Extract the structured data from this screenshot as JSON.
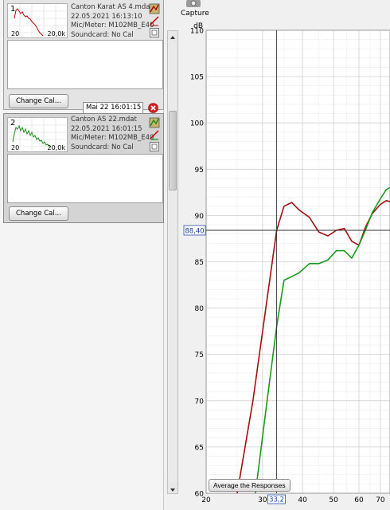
{
  "measurements": [
    {
      "index": "1",
      "thumb_lo": "20",
      "thumb_hi": "20,0k",
      "filename": "Canton Karat AS 4.mdat",
      "date": "22.05.2021 16:13:10",
      "mic": "Mic/Meter: M102MB_E40",
      "soundcard": "Soundcard: No Cal",
      "change_cal": "Change Cal...",
      "color": "#c00000"
    },
    {
      "index": "2",
      "thumb_lo": "20",
      "thumb_hi": "20,0k",
      "name_field": "Mai 22 16:01:15",
      "filename": "Canton AS 22.mdat",
      "date": "22.05.2021 16:01:15",
      "mic": "Mic/Meter: M102MB_E40",
      "soundcard": "Soundcard: No Cal",
      "change_cal": "Change Cal...",
      "color": "#1a8a1a"
    }
  ],
  "toolbar": {
    "capture_label": "Capture"
  },
  "graph": {
    "y_unit": "dB",
    "y_ticks": [
      "110",
      "105",
      "100",
      "95",
      "90",
      "85",
      "80",
      "75",
      "70",
      "65",
      "60"
    ],
    "x_ticks": [
      "20",
      "30",
      "40",
      "50",
      "60",
      "70"
    ],
    "cursor_y_label": "88,40",
    "cursor_x_label": "33,2",
    "average_button": "Average the Responses"
  },
  "chart_data": {
    "type": "line",
    "xlabel": "",
    "ylabel": "dB",
    "ylim": [
      60,
      110
    ],
    "xlim": [
      20,
      75
    ],
    "x_scale": "log",
    "cursor": {
      "x": 33.2,
      "y": 88.4
    },
    "series": [
      {
        "color": "#a01010",
        "x": [
          25,
          28,
          31,
          33.2,
          35,
          37,
          39,
          42,
          45,
          48,
          51,
          54,
          57,
          60,
          63,
          66,
          70,
          73,
          75
        ],
        "y": [
          60,
          70,
          81,
          88.4,
          91,
          91.4,
          90.6,
          89.8,
          88.2,
          87.8,
          88.4,
          88.6,
          87.2,
          86.8,
          88.8,
          90.2,
          91.2,
          91.6,
          91.5
        ]
      },
      {
        "color": "#1a9a1a",
        "x": [
          28.5,
          31,
          33.2,
          35,
          37,
          39,
          42,
          45,
          48,
          51,
          54,
          57,
          60,
          63,
          66,
          70,
          73,
          75
        ],
        "y": [
          60,
          70,
          78,
          83,
          83.4,
          83.8,
          84.8,
          84.8,
          85.2,
          86.2,
          86.2,
          85.4,
          86.8,
          88.5,
          90.3,
          91.8,
          92.8,
          93
        ]
      }
    ]
  }
}
